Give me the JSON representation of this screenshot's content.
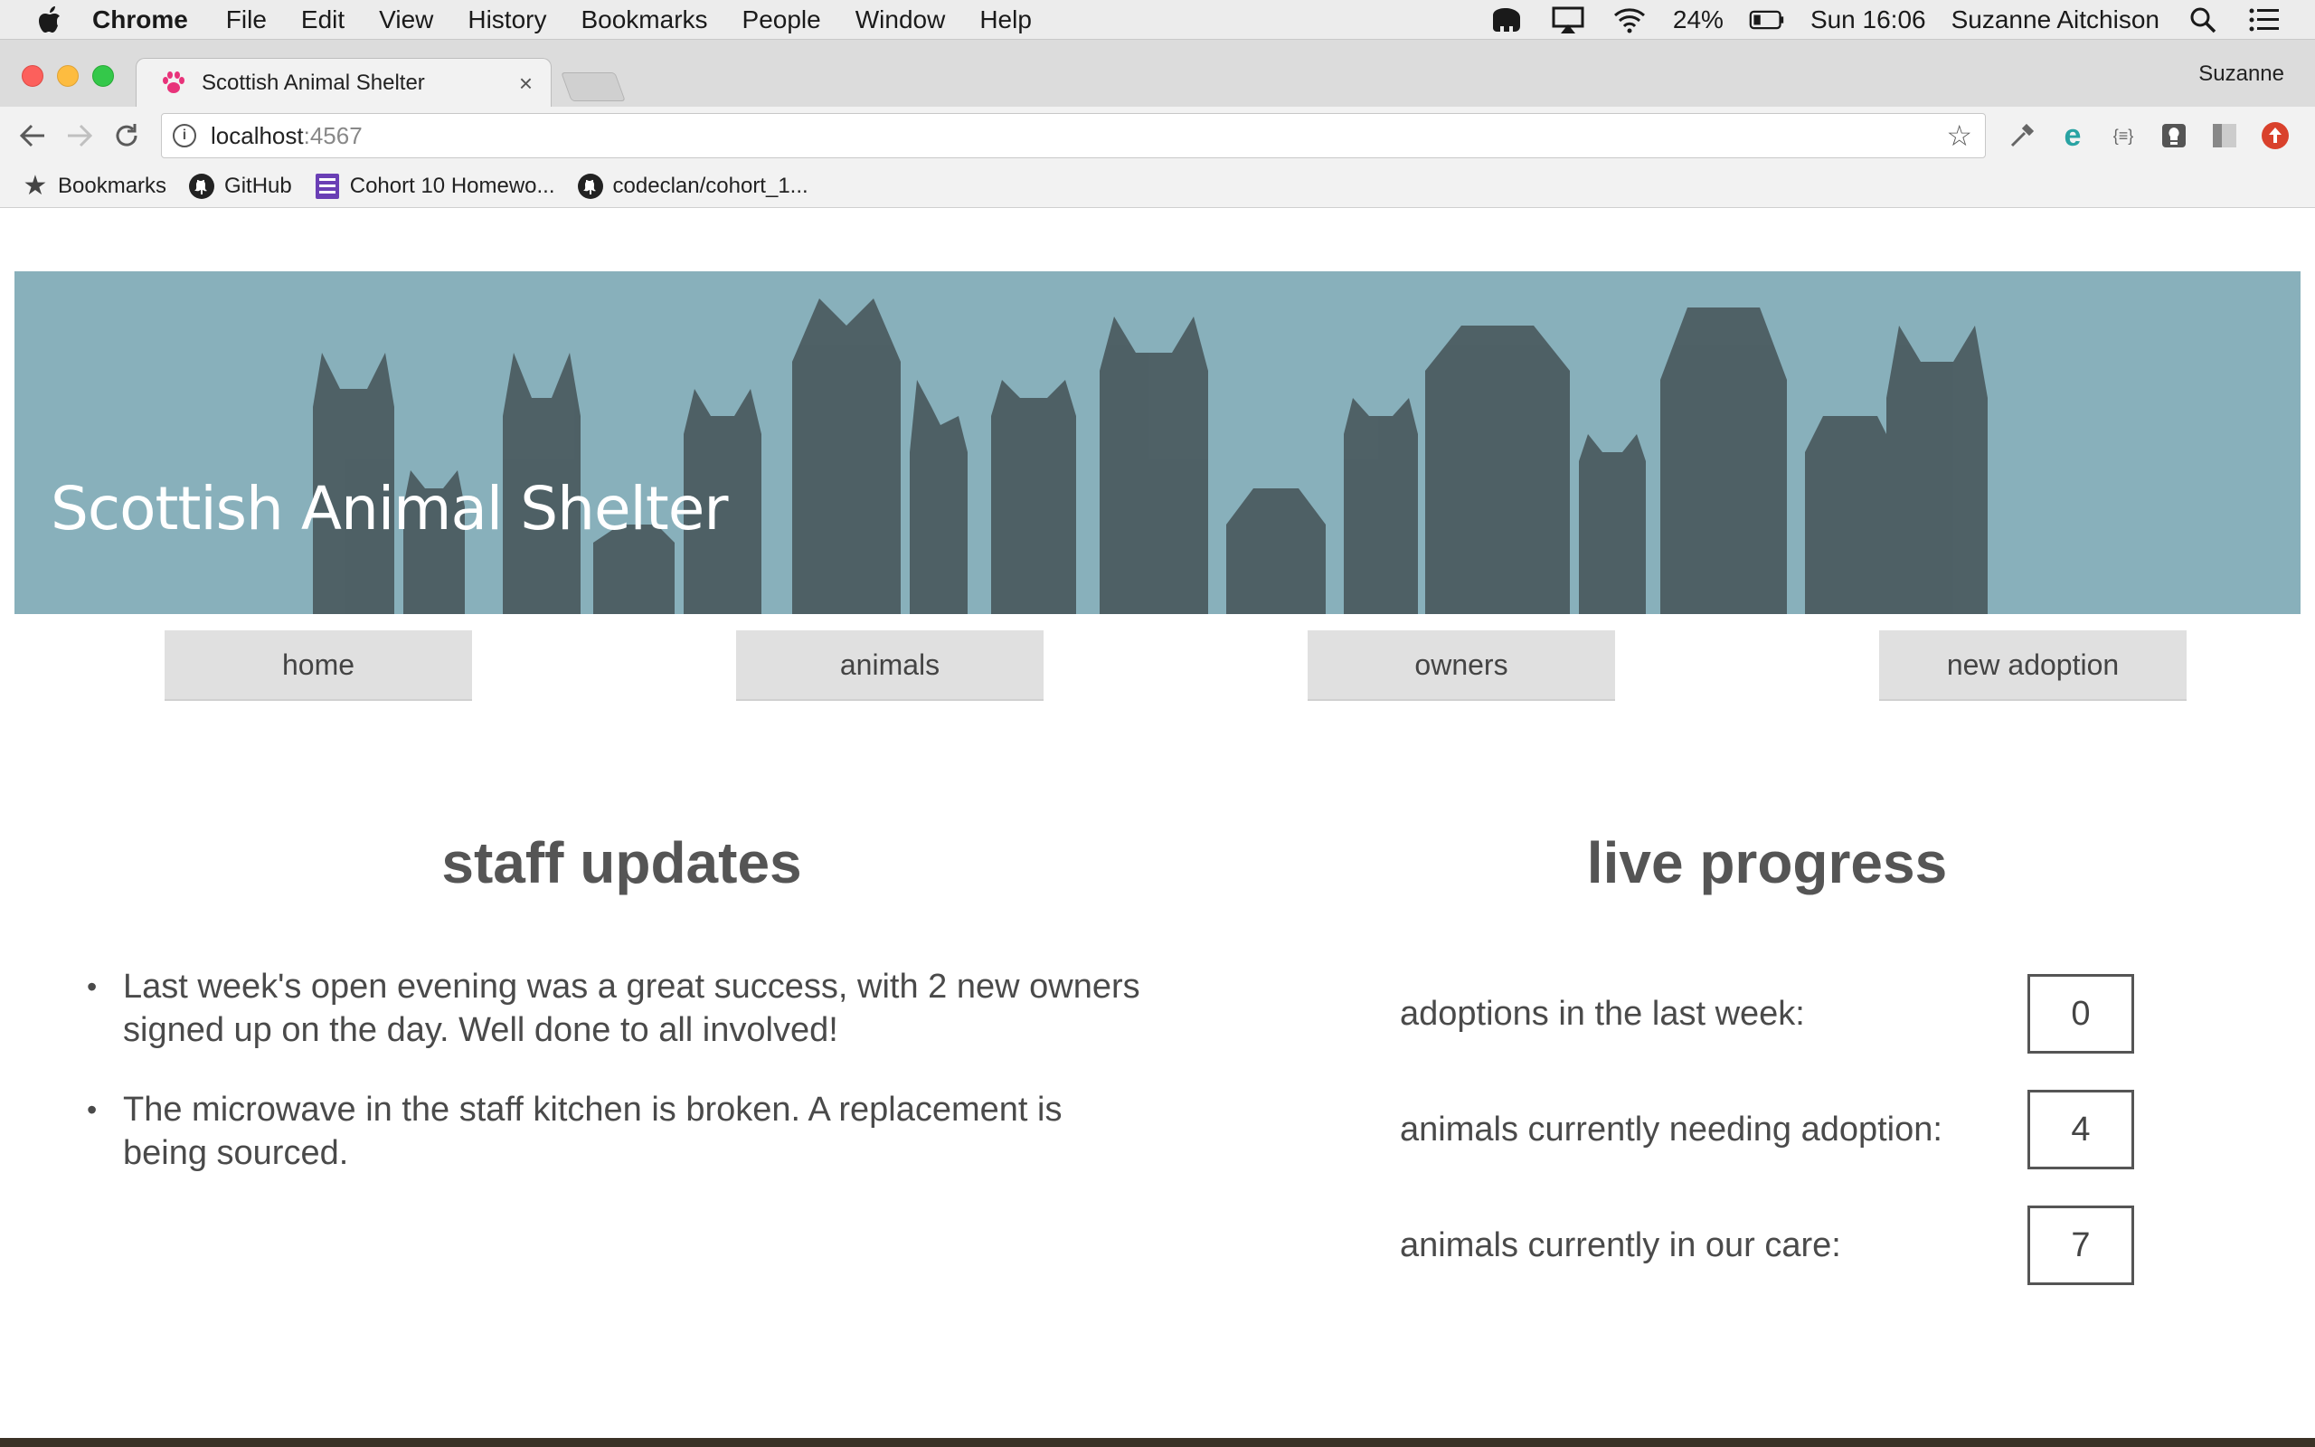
{
  "menubar": {
    "app_name": "Chrome",
    "items": [
      "File",
      "Edit",
      "View",
      "History",
      "Bookmarks",
      "People",
      "Window",
      "Help"
    ],
    "battery": "24%",
    "clock": "Sun 16:06",
    "user": "Suzanne Aitchison"
  },
  "browser": {
    "tab_title": "Scottish Animal Shelter",
    "profile_name": "Suzanne",
    "url_host": "localhost",
    "url_port": ":4567",
    "bookmarks": [
      {
        "label": "Bookmarks",
        "icon": "star-icon"
      },
      {
        "label": "GitHub",
        "icon": "github-icon"
      },
      {
        "label": "Cohort 10 Homewo...",
        "icon": "sheets-icon"
      },
      {
        "label": "codeclan/cohort_1...",
        "icon": "github-icon"
      }
    ]
  },
  "page": {
    "site_title": "Scottish Animal Shelter",
    "nav": [
      "home",
      "animals",
      "owners",
      "new adoption"
    ],
    "staff_updates": {
      "heading": "staff updates",
      "items": [
        "Last week's open evening was a great success, with 2 new owners signed up on the day. Well done to all involved!",
        "The microwave in the staff kitchen is broken. A replacement is being sourced."
      ]
    },
    "live_progress": {
      "heading": "live progress",
      "stats": [
        {
          "label": "adoptions in the last week:",
          "value": "0"
        },
        {
          "label": "animals currently needing adoption:",
          "value": "4"
        },
        {
          "label": "animals currently in our care:",
          "value": "7"
        }
      ]
    }
  },
  "colors": {
    "banner_bg": "#88b0bb",
    "nav_button_bg": "#e0e0e0",
    "text": "#4a4a4a"
  }
}
